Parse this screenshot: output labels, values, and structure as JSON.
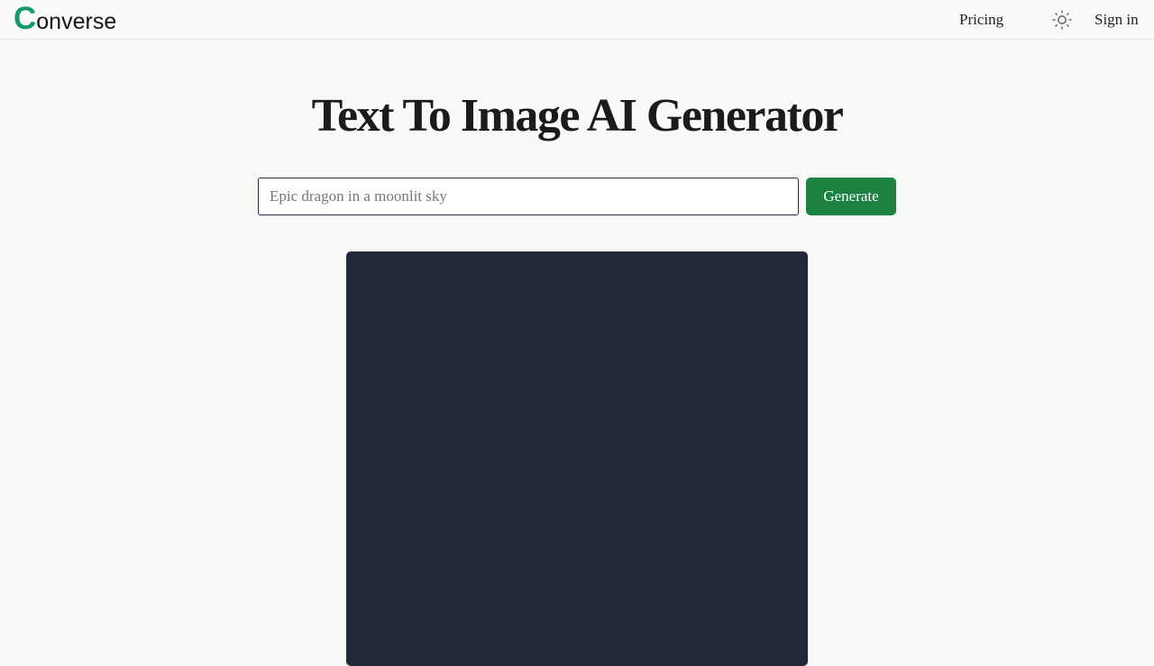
{
  "brand": {
    "logo_initial": "C",
    "logo_rest": "onverse",
    "accent_color": "#16996b"
  },
  "nav": {
    "pricing_label": "Pricing",
    "theme_icon": "sun-icon",
    "signin_label": "Sign in"
  },
  "main": {
    "title": "Text To Image AI Generator",
    "prompt": {
      "value": "",
      "placeholder": "Epic dragon in a moonlit sky"
    },
    "generate_label": "Generate",
    "generate_color": "#1b8241",
    "image_placeholder_color": "#212938"
  }
}
